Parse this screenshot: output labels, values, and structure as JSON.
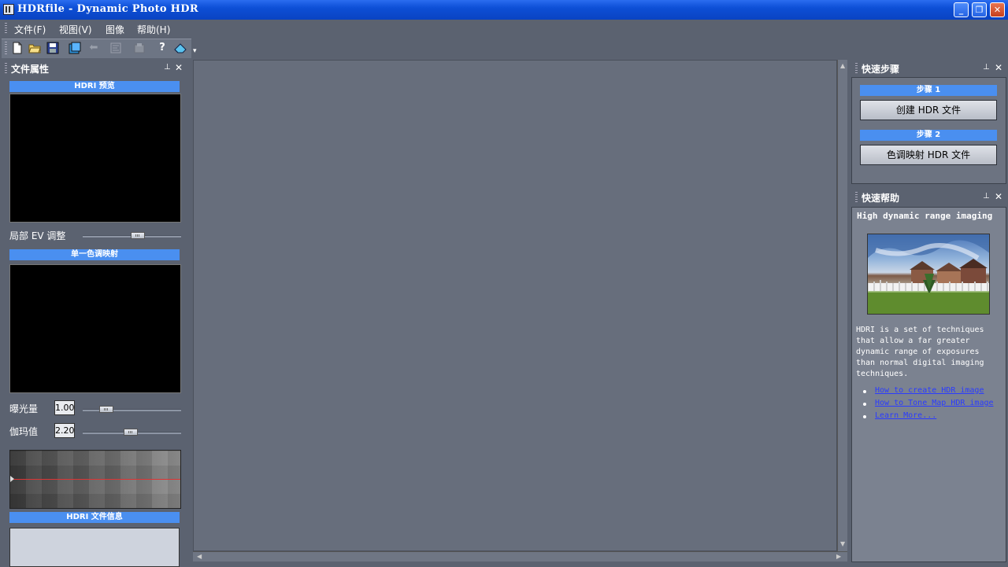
{
  "window": {
    "title": "HDRfile - Dynamic Photo HDR",
    "minimize": "_",
    "restore": "❐",
    "close": "✕"
  },
  "menu": {
    "items": [
      "文件(F)",
      "视图(V)",
      "图像",
      "帮助(H)"
    ]
  },
  "toolbar": {
    "icons": [
      "new-file-icon",
      "open-folder-icon",
      "save-icon",
      "save-as-icon",
      "back-arrow-icon",
      "align-icon",
      "batch-icon",
      "help-question-icon",
      "eraser-icon"
    ],
    "overflow": "▾"
  },
  "left_panel": {
    "title": "文件属性",
    "pin": "⊥",
    "close": "✕",
    "sections": {
      "preview": "HDRI 预览",
      "tonemap": "单一色调映射",
      "info": "HDRI 文件信息"
    },
    "local_ev_label": "局部 EV 调整",
    "local_ev_level": 0.57,
    "exposure": {
      "label": "曝光量",
      "value": "1.00",
      "level": 0.2
    },
    "gamma": {
      "label": "伽玛值",
      "value": "2.20",
      "level": 0.49
    }
  },
  "right_panel": {
    "steps": {
      "title": "快速步骤",
      "pin": "⊥",
      "close": "✕",
      "step1_label": "步骤 1",
      "step1_button": "创建 HDR 文件",
      "step2_label": "步骤 2",
      "step2_button": "色调映射 HDR 文件"
    },
    "help": {
      "title": "快速帮助",
      "pin": "⊥",
      "close": "✕",
      "heading": "High dynamic range imaging",
      "body": "HDRI is a set of techniques that allow a far greater dynamic range of exposures than normal digital imaging techniques.",
      "links": [
        "How to create HDR image",
        "How to Tone Map HDR image",
        "Learn More..."
      ]
    }
  },
  "colors": {
    "accent_bar": "#4a8ff0",
    "background": "#5b6270",
    "workspace": "#676e7c",
    "link": "#2a3bff"
  }
}
